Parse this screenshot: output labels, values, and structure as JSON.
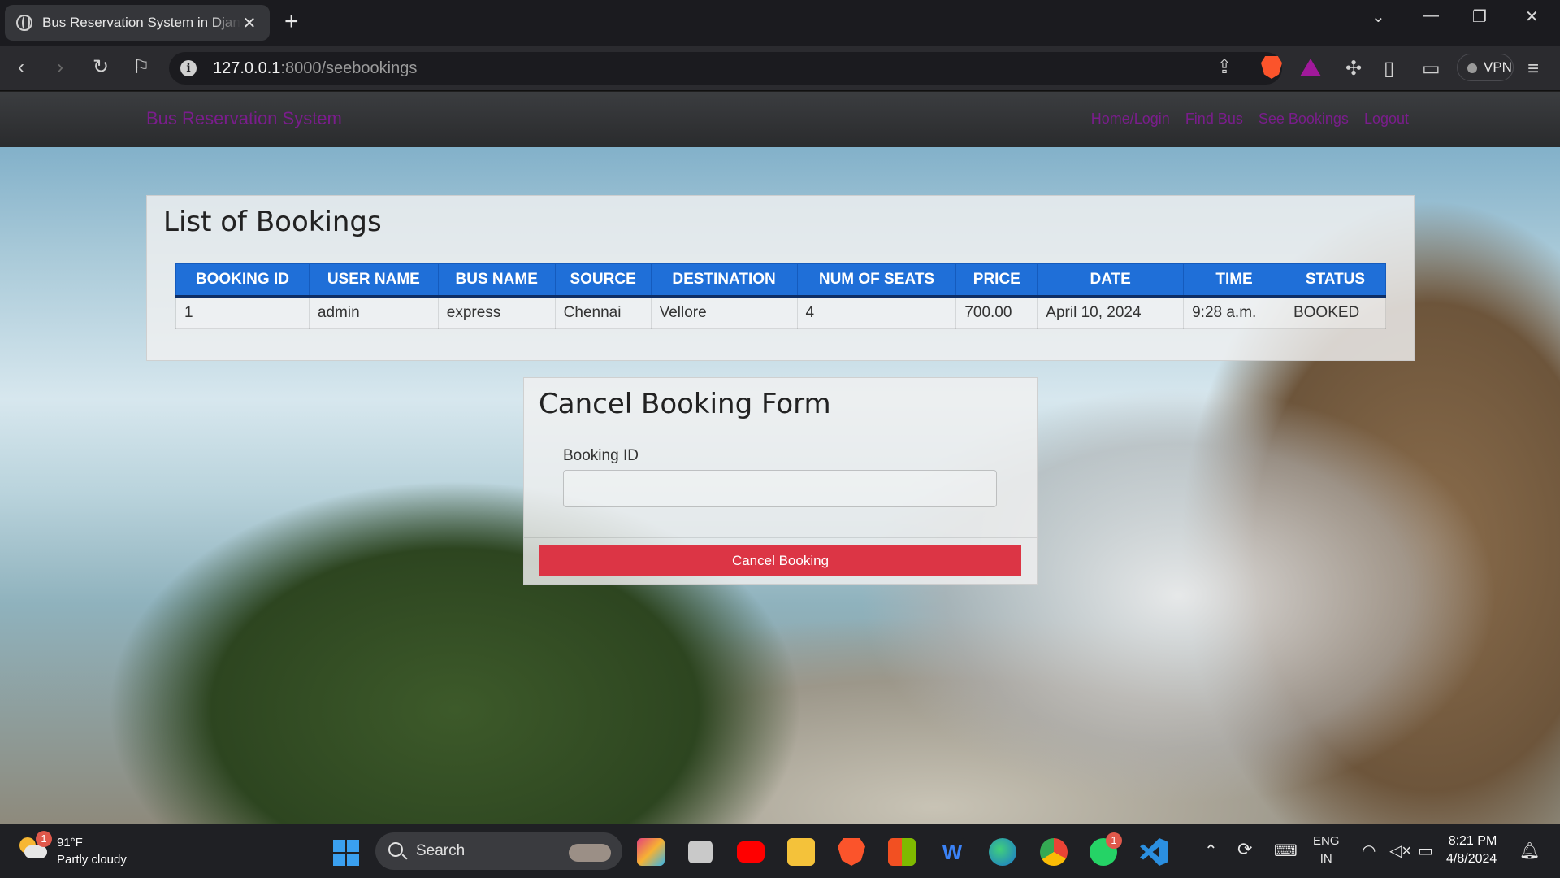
{
  "browser": {
    "tab_title": "Bus Reservation System in Django",
    "url_host": "127.0.0.1",
    "url_rest": ":8000/seebookings",
    "vpn_label": "VPN"
  },
  "site": {
    "brand": "Bus Reservation System",
    "nav": [
      "Home/Login",
      "Find Bus",
      "See Bookings",
      "Logout"
    ]
  },
  "bookings": {
    "heading": "List of Bookings",
    "columns": [
      "BOOKING ID",
      "USER NAME",
      "BUS NAME",
      "SOURCE",
      "DESTINATION",
      "NUM OF SEATS",
      "PRICE",
      "DATE",
      "TIME",
      "STATUS"
    ],
    "rows": [
      [
        "1",
        "admin",
        "express",
        "Chennai",
        "Vellore",
        "4",
        "700.00",
        "April 10, 2024",
        "9:28 a.m.",
        "BOOKED"
      ]
    ]
  },
  "cancel_form": {
    "heading": "Cancel Booking Form",
    "field_label": "Booking ID",
    "field_value": "",
    "button_label": "Cancel Booking"
  },
  "taskbar": {
    "weather_temp": "91°F",
    "weather_desc": "Partly cloudy",
    "weather_badge": "1",
    "search_label": "Search",
    "whatsapp_badge": "1",
    "lang_top": "ENG",
    "lang_bottom": "IN",
    "time": "8:21 PM",
    "date": "4/8/2024"
  },
  "colors": {
    "table_header": "#1f6fd8",
    "cancel_button": "#dc3545",
    "brand_link": "#7a1d8c"
  }
}
